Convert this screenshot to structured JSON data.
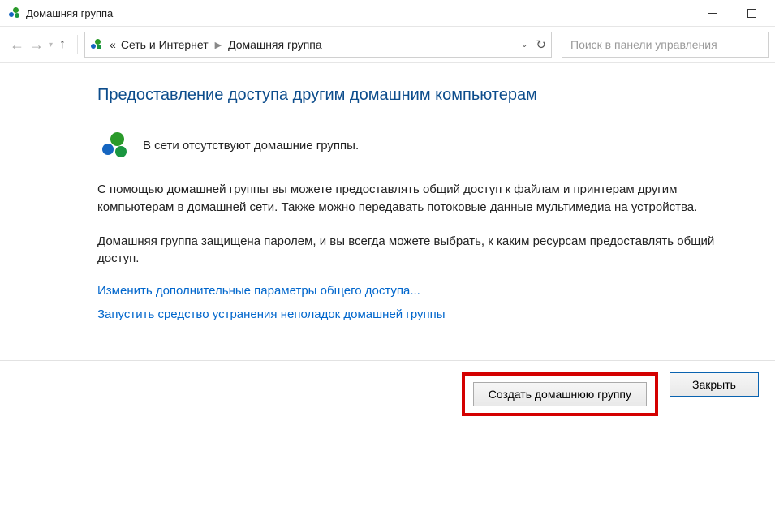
{
  "window": {
    "title": "Домашняя группа"
  },
  "breadcrumb": {
    "root_prefix": "«",
    "root": "Сеть и Интернет",
    "current": "Домашняя группа"
  },
  "search": {
    "placeholder": "Поиск в панели управления"
  },
  "main": {
    "heading": "Предоставление доступа другим домашним компьютерам",
    "status": "В сети отсутствуют домашние группы.",
    "para1": "С помощью домашней группы вы можете предоставлять общий доступ к файлам и принтерам другим компьютерам в домашней сети. Также можно передавать потоковые данные мультимедиа на устройства.",
    "para2": "Домашняя группа защищена паролем, и вы всегда можете выбрать, к каким ресурсам предоставлять общий доступ.",
    "link_advanced": "Изменить дополнительные параметры общего доступа...",
    "link_troubleshoot": "Запустить средство устранения неполадок домашней группы"
  },
  "footer": {
    "create": "Создать домашнюю группу",
    "close": "Закрыть"
  }
}
